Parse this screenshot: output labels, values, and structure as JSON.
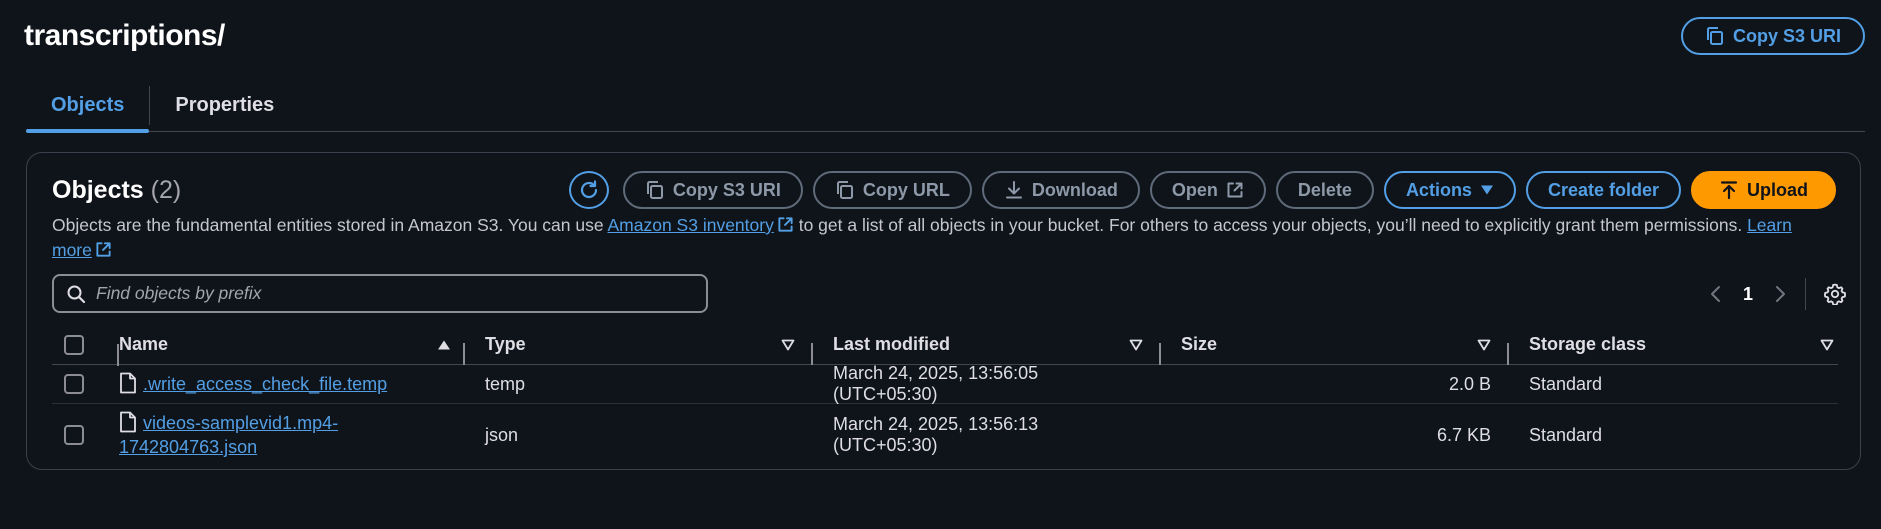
{
  "header": {
    "title": "transcriptions/",
    "copy_s3_uri_label": "Copy S3 URI"
  },
  "tabs": [
    {
      "label": "Objects",
      "active": true
    },
    {
      "label": "Properties",
      "active": false
    }
  ],
  "objects_panel": {
    "title": "Objects",
    "count": "(2)",
    "toolbar": {
      "copy_s3_uri": "Copy S3 URI",
      "copy_url": "Copy URL",
      "download": "Download",
      "open": "Open",
      "delete": "Delete",
      "actions": "Actions",
      "create_folder": "Create folder",
      "upload": "Upload"
    },
    "description": {
      "part1": "Objects are the fundamental entities stored in Amazon S3. You can use ",
      "link1": "Amazon S3 inventory",
      "part2": " to get a list of all objects in your bucket. For others to access your objects, you’ll need to explicitly grant them permissions. ",
      "link2": "Learn more"
    },
    "search": {
      "placeholder": "Find objects by prefix",
      "value": ""
    },
    "pagination": {
      "current_page": "1"
    },
    "table": {
      "columns": [
        "Name",
        "Type",
        "Last modified",
        "Size",
        "Storage class"
      ],
      "rows": [
        {
          "name": ".write_access_check_file.temp",
          "type": "temp",
          "last_modified": "March 24, 2025, 13:56:05 (UTC+05:30)",
          "size": "2.0 B",
          "storage_class": "Standard"
        },
        {
          "name_line1": "videos-samplevid1.mp4-",
          "name_line2": "1742804763.json",
          "type": "json",
          "last_modified": "March 24, 2025, 13:56:13 (UTC+05:30)",
          "size": "6.7 KB",
          "storage_class": "Standard"
        }
      ]
    }
  },
  "colors": {
    "background": "#0f141a",
    "link": "#539fe5",
    "primary": "#ff9900",
    "border": "#424650"
  }
}
